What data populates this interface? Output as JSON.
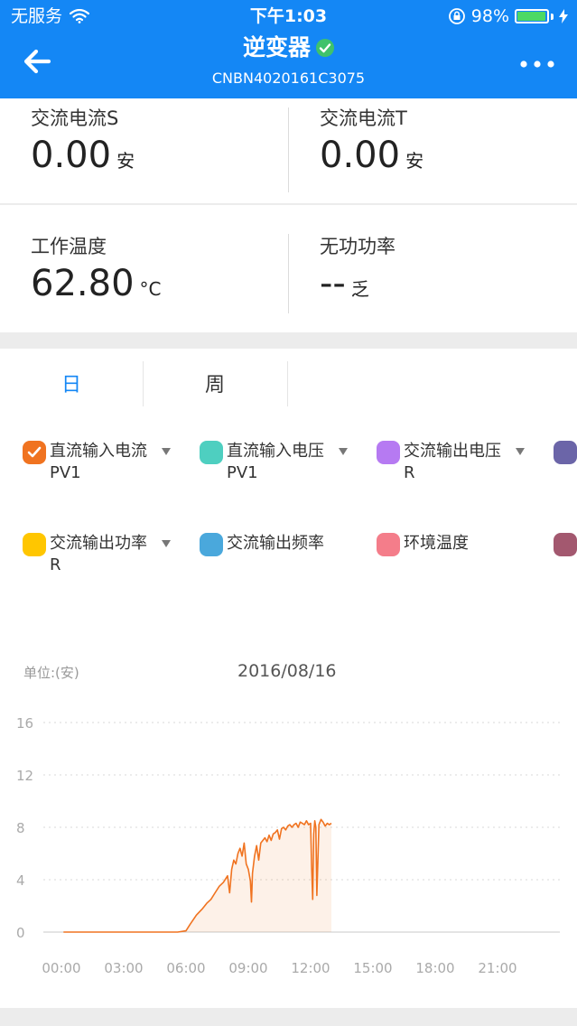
{
  "status_bar": {
    "carrier": "无服务",
    "time": "下午1:03",
    "battery_percent": "98%",
    "battery_level": 0.98
  },
  "nav": {
    "title": "逆变器",
    "subtitle": "CNBN4020161C3075",
    "icons": [
      "back-arrow-icon",
      "verified-check-icon",
      "more-dots-icon"
    ]
  },
  "metrics": [
    {
      "label": "交流电流S",
      "value": "0.00",
      "unit": "安"
    },
    {
      "label": "交流电流T",
      "value": "0.00",
      "unit": "安"
    },
    {
      "label": "工作温度",
      "value": "62.80",
      "unit": "°C"
    },
    {
      "label": "无功功率",
      "value": "--",
      "unit": "乏"
    }
  ],
  "tabs": [
    {
      "label": "日",
      "active": true
    },
    {
      "label": "周",
      "active": false
    }
  ],
  "legend": [
    {
      "text": "直流输入电流",
      "sub": "PV1",
      "color": "#f07320",
      "checked": true,
      "dropdown": true
    },
    {
      "text": "直流输入电压",
      "sub": "PV1",
      "color": "#4ecfc0",
      "checked": false,
      "dropdown": true
    },
    {
      "text": "交流输出电压",
      "sub": "R",
      "color": "#b67af2",
      "checked": false,
      "dropdown": true
    },
    {
      "text": "",
      "sub": "",
      "color": "#6b65a8",
      "checked": false,
      "dropdown": false
    },
    {
      "text": "交流输出功率",
      "sub": "R",
      "color": "#ffc600",
      "checked": false,
      "dropdown": true
    },
    {
      "text": "交流输出频率",
      "sub": "",
      "color": "#4aa8dc",
      "checked": false,
      "dropdown": false
    },
    {
      "text": "环境温度",
      "sub": "",
      "color": "#f47d8a",
      "checked": false,
      "dropdown": false
    },
    {
      "text": "",
      "sub": "",
      "color": "#a3586f",
      "checked": false,
      "dropdown": false
    }
  ],
  "chart": {
    "unit_label": "单位:(安)",
    "date": "2016/08/16"
  },
  "chart_data": {
    "type": "area",
    "ylim": [
      0,
      16
    ],
    "yticks": [
      "0",
      "4",
      "8",
      "12",
      "16"
    ],
    "xlim": [
      0,
      24
    ],
    "xticks": [
      "00:00",
      "03:00",
      "06:00",
      "09:00",
      "12:00",
      "15:00",
      "18:00",
      "21:00"
    ],
    "series": [
      {
        "color": "#f07320",
        "x": [
          0.1,
          1,
          2,
          3,
          4,
          5,
          5.6,
          6.0,
          6.2,
          6.5,
          6.8,
          7.0,
          7.2,
          7.4,
          7.6,
          7.8,
          8.0,
          8.1,
          8.2,
          8.3,
          8.4,
          8.5,
          8.6,
          8.7,
          8.8,
          8.9,
          9.0,
          9.1,
          9.15,
          9.2,
          9.3,
          9.4,
          9.5,
          9.6,
          9.7,
          9.8,
          9.9,
          10.0,
          10.1,
          10.2,
          10.3,
          10.4,
          10.5,
          10.6,
          10.7,
          10.8,
          10.9,
          11.0,
          11.1,
          11.2,
          11.3,
          11.4,
          11.5,
          11.6,
          11.7,
          11.8,
          11.9,
          12.0,
          12.05,
          12.1,
          12.15,
          12.2,
          12.25,
          12.3,
          12.4,
          12.5,
          12.6,
          12.7,
          12.8,
          12.9,
          13.0
        ],
        "y": [
          0,
          0,
          0,
          0,
          0,
          0,
          0,
          0.1,
          0.6,
          1.3,
          1.8,
          2.2,
          2.5,
          3.0,
          3.5,
          3.8,
          4.3,
          3.0,
          4.8,
          5.5,
          5.2,
          6.0,
          6.4,
          5.8,
          6.8,
          5.2,
          4.8,
          3.9,
          2.3,
          4.5,
          5.8,
          6.6,
          5.5,
          6.8,
          7.0,
          7.2,
          6.9,
          7.4,
          7.0,
          7.5,
          7.6,
          7.8,
          7.1,
          7.9,
          8.0,
          7.8,
          8.1,
          8.2,
          8.0,
          8.2,
          8.3,
          8.0,
          8.4,
          8.3,
          8.2,
          8.5,
          8.2,
          8.3,
          5.0,
          2.5,
          7.5,
          8.5,
          8.0,
          2.8,
          8.2,
          8.6,
          8.4,
          8.1,
          8.3,
          8.2,
          8.3
        ]
      }
    ],
    "grid": true
  }
}
